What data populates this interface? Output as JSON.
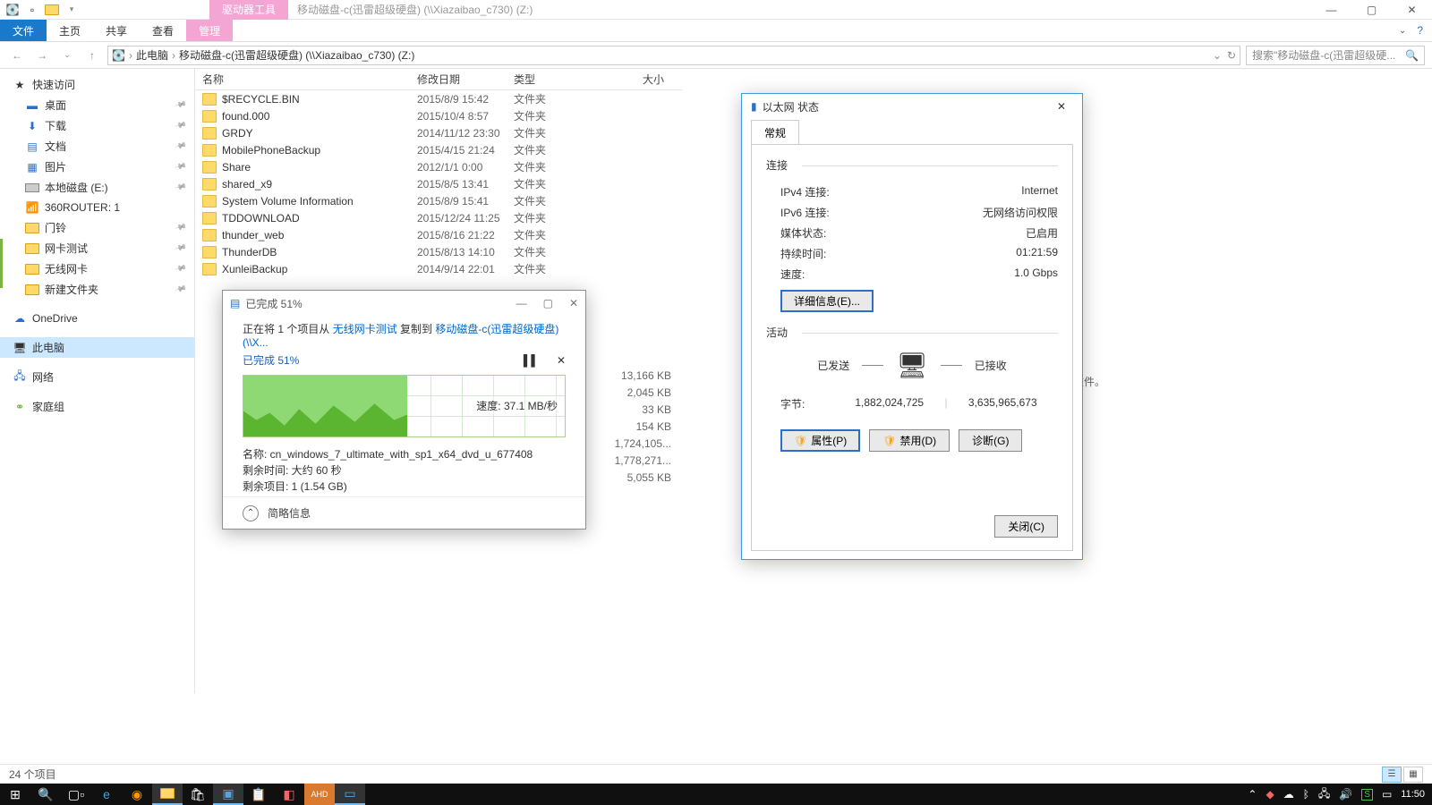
{
  "titlebar": {
    "contextTab": "驱动器工具",
    "title": "移动磁盘-c(迅雷超级硬盘) (\\\\Xiazaibao_c730) (Z:)"
  },
  "ribbon": {
    "file": "文件",
    "tabs": [
      "主页",
      "共享",
      "查看",
      "管理"
    ]
  },
  "breadcrumb": {
    "root": "此电脑",
    "path": "移动磁盘-c(迅雷超级硬盘) (\\\\Xiazaibao_c730) (Z:)"
  },
  "search": {
    "placeholder": "搜索\"移动磁盘-c(迅雷超级硬..."
  },
  "sidebar": {
    "quick": "快速访问",
    "items": [
      {
        "label": "桌面",
        "icon": "🖥"
      },
      {
        "label": "下载",
        "icon": "⬇"
      },
      {
        "label": "文档",
        "icon": "📄"
      },
      {
        "label": "图片",
        "icon": "🖼"
      },
      {
        "label": "本地磁盘 (E:)",
        "icon": "💽"
      },
      {
        "label": "360ROUTER: 1",
        "icon": "📡"
      },
      {
        "label": "门铃",
        "icon": "📁"
      },
      {
        "label": "网卡测试",
        "icon": "📁"
      },
      {
        "label": "无线网卡",
        "icon": "📁"
      },
      {
        "label": "新建文件夹",
        "icon": "📁"
      }
    ],
    "onedrive": "OneDrive",
    "thispc": "此电脑",
    "network": "网络",
    "homegroup": "家庭组"
  },
  "columns": {
    "name": "名称",
    "date": "修改日期",
    "type": "类型",
    "size": "大小"
  },
  "files": [
    {
      "name": "$RECYCLE.BIN",
      "date": "2015/8/9 15:42",
      "type": "文件夹",
      "size": ""
    },
    {
      "name": "found.000",
      "date": "2015/10/4 8:57",
      "type": "文件夹",
      "size": ""
    },
    {
      "name": "GRDY",
      "date": "2014/11/12 23:30",
      "type": "文件夹",
      "size": ""
    },
    {
      "name": "MobilePhoneBackup",
      "date": "2015/4/15 21:24",
      "type": "文件夹",
      "size": ""
    },
    {
      "name": "Share",
      "date": "2012/1/1 0:00",
      "type": "文件夹",
      "size": ""
    },
    {
      "name": "shared_x9",
      "date": "2015/8/5 13:41",
      "type": "文件夹",
      "size": ""
    },
    {
      "name": "System Volume Information",
      "date": "2015/8/9 15:41",
      "type": "文件夹",
      "size": ""
    },
    {
      "name": "TDDOWNLOAD",
      "date": "2015/12/24 11:25",
      "type": "文件夹",
      "size": ""
    },
    {
      "name": "thunder_web",
      "date": "2015/8/16 21:22",
      "type": "文件夹",
      "size": ""
    },
    {
      "name": "ThunderDB",
      "date": "2015/8/13 14:10",
      "type": "文件夹",
      "size": ""
    },
    {
      "name": "XunleiBackup",
      "date": "2014/9/14 22:01",
      "type": "文件夹",
      "size": ""
    }
  ],
  "extra_sizes": [
    "13,166 KB",
    "2,045 KB",
    "33 KB",
    "154 KB",
    "1,724,105...",
    "1,778,271...",
    "5,055 KB"
  ],
  "preview_text": "选择要预览的文件。",
  "copy": {
    "title": "已完成 51%",
    "line_prefix": "正在将 1 个项目从 ",
    "src": "无线网卡测试",
    "mid": " 复制到 ",
    "dest": "移动磁盘-c(迅雷超级硬盘) (\\\\X...",
    "heading": "已完成 51%",
    "speed": "速度: 37.1 MB/秒",
    "name_lbl": "名称: cn_windows_7_ultimate_with_sp1_x64_dvd_u_677408",
    "time_lbl": "剩余时间: 大约 60 秒",
    "items_lbl": "剩余项目: 1 (1.54 GB)",
    "brief": "简略信息"
  },
  "eth": {
    "title": "以太网 状态",
    "tab": "常规",
    "conn_section": "连接",
    "ipv4_k": "IPv4 连接:",
    "ipv4_v": "Internet",
    "ipv6_k": "IPv6 连接:",
    "ipv6_v": "无网络访问权限",
    "media_k": "媒体状态:",
    "media_v": "已启用",
    "dur_k": "持续时间:",
    "dur_v": "01:21:59",
    "speed_k": "速度:",
    "speed_v": "1.0 Gbps",
    "details": "详细信息(E)...",
    "activity_section": "活动",
    "sent": "已发送",
    "recv": "已接收",
    "bytes_lbl": "字节:",
    "bytes_sent": "1,882,024,725",
    "bytes_recv": "3,635,965,673",
    "props": "属性(P)",
    "disable": "禁用(D)",
    "diag": "诊断(G)",
    "close": "关闭(C)"
  },
  "status": {
    "count": "24 个项目"
  },
  "clock": "11:50"
}
